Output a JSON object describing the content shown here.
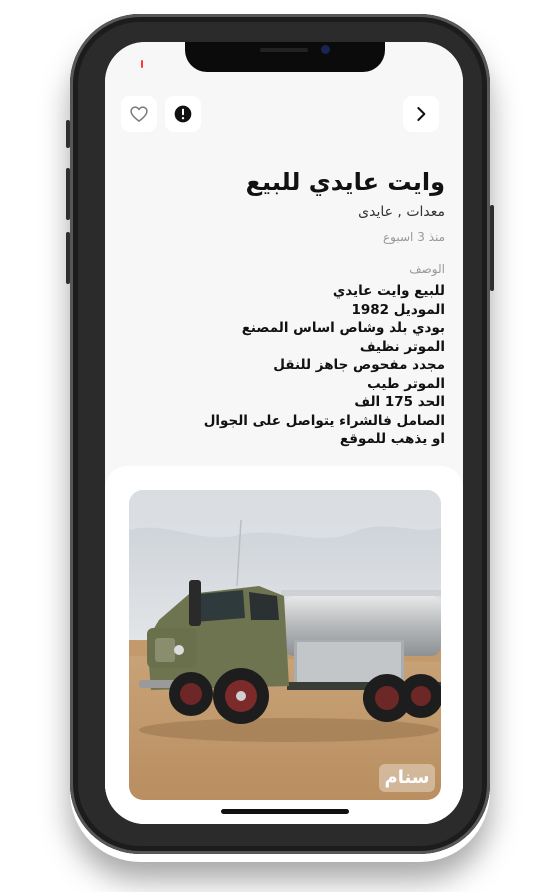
{
  "header": {
    "back_icon": "chevron-right-icon",
    "favorite_icon": "heart-outline-icon",
    "report_icon": "alert-icon"
  },
  "listing": {
    "title": "وايت عايدي للبيع",
    "tags": "معدات , عايدى",
    "posted": "منذ 3 اسبوع",
    "description_label": "الوصف",
    "description_lines": [
      "للبيع وايت عايدي",
      "الموديل 1982",
      "بودي بلد وشاص اساس المصنع",
      "الموتر نظيف",
      "مجدد مفحوص جاهز للنقل",
      "الموتر طيب",
      "الحد 175 الف",
      "الصامل فالشراء يتواصل على الجوال",
      "او يذهب للموقع"
    ]
  },
  "photo": {
    "watermark": "سنام",
    "subject": "old green tanker truck in desert"
  },
  "colors": {
    "app_background": "#f7f7f7",
    "card_background": "#ffffff",
    "text_primary": "#111111",
    "text_secondary": "#9a9a9a",
    "phone_frame": "#2b2b2b"
  }
}
